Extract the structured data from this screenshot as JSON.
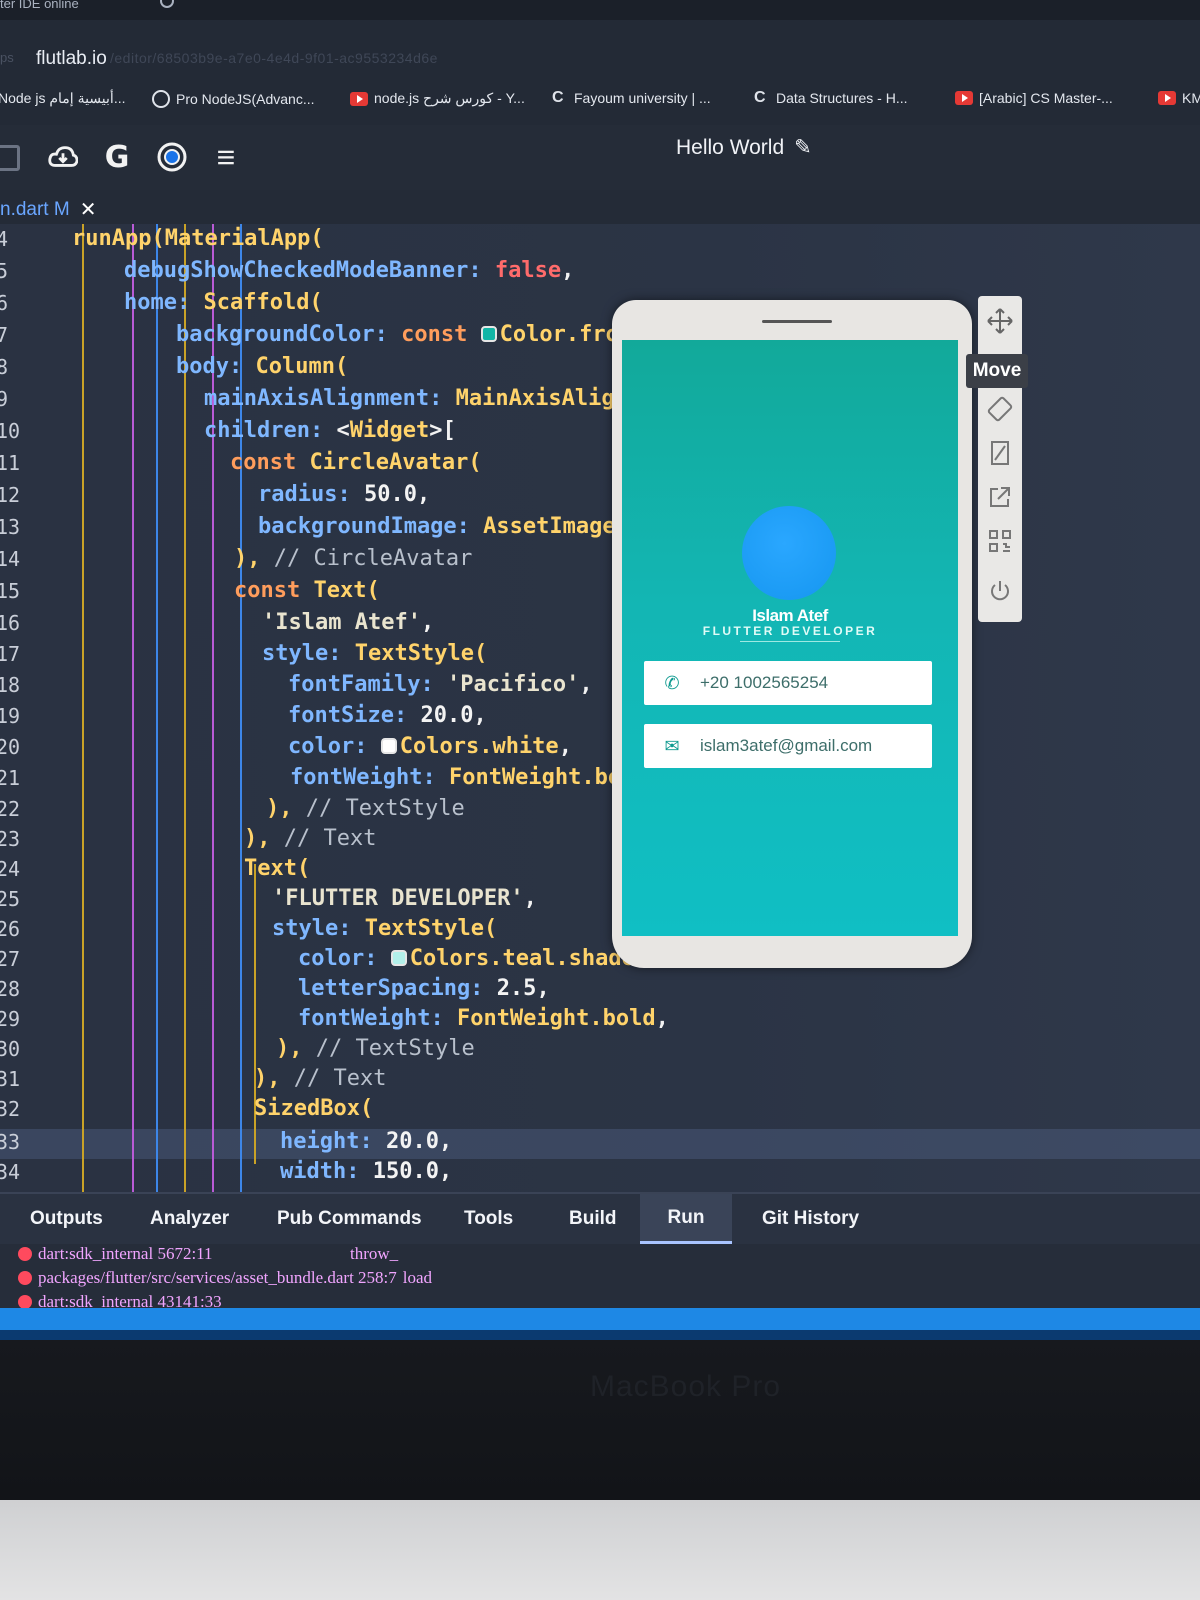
{
  "browser": {
    "tab_partial_title": "ter IDE online",
    "address_prefix": "ps",
    "address_host": "flutlab.io",
    "address_rest": "/editor/68503b9e-a7e0-4e4d-9f01-ac9553234d6e",
    "bookmarks": [
      {
        "label": "Node js أبيسية إمام...",
        "icon": "none"
      },
      {
        "label": "Pro NodeJS(Advanc...",
        "icon": "globe-icon"
      },
      {
        "label": "node.js كورس شرح - Y...",
        "icon": "youtube-icon"
      },
      {
        "label": "Fayoum university | ...",
        "icon": "c-icon"
      },
      {
        "label": "Data Structures - H...",
        "icon": "c-icon"
      },
      {
        "label": "[Arabic] CS Master-...",
        "icon": "youtube-icon"
      },
      {
        "label": "KM",
        "icon": "youtube-icon"
      }
    ]
  },
  "toolbar": {
    "google_label": "G",
    "menu_label": "≡",
    "project_title": "Hello World",
    "edit_icon": "✎"
  },
  "file_tab": {
    "name": "n.dart M",
    "close": "✕"
  },
  "code": {
    "line_numbers": [
      "4",
      "5",
      "6",
      "7",
      "8",
      "9",
      "10",
      "11",
      "12",
      "13",
      "14",
      "15",
      "16",
      "17",
      "18",
      "19",
      "20",
      "21",
      "22",
      "23",
      "24",
      "25",
      "26",
      "27",
      "28",
      "29",
      "30",
      "31",
      "32",
      "33",
      "34"
    ]
  },
  "preview": {
    "name": "Islam Atef",
    "role": "FLUTTER DEVELOPER",
    "phone": "+20 1002565254",
    "email": "islam3atef@gmail.com",
    "phone_icon": "✆",
    "email_icon": "✉"
  },
  "device_tools": {
    "move_tooltip": "Move",
    "items": [
      "move-icon",
      "rotate-icon",
      "resize-icon",
      "open-external-icon",
      "qr-code-icon",
      "power-icon"
    ]
  },
  "panel": {
    "tabs": [
      "Outputs",
      "Analyzer",
      "Pub Commands",
      "Tools",
      "Build",
      "Run",
      "Git History"
    ],
    "active_tab": "Run",
    "logs": [
      {
        "text": "dart:sdk_internal 5672:11",
        "extra": "throw_"
      },
      {
        "text": "packages/flutter/src/services/asset_bundle.dart 258:7",
        "extra": "load"
      },
      {
        "text": "dart:sdk_internal 43141:33",
        "extra": ""
      }
    ]
  },
  "laptop": {
    "label": "MacBook Pro"
  },
  "colors": {
    "editor_bg": "#2b3445",
    "preview_teal": "#13b6b4",
    "accent_blue": "#1e88e5",
    "keyword": "#ff9d5c",
    "type": "#ffd36b",
    "property": "#7fb7ff"
  }
}
